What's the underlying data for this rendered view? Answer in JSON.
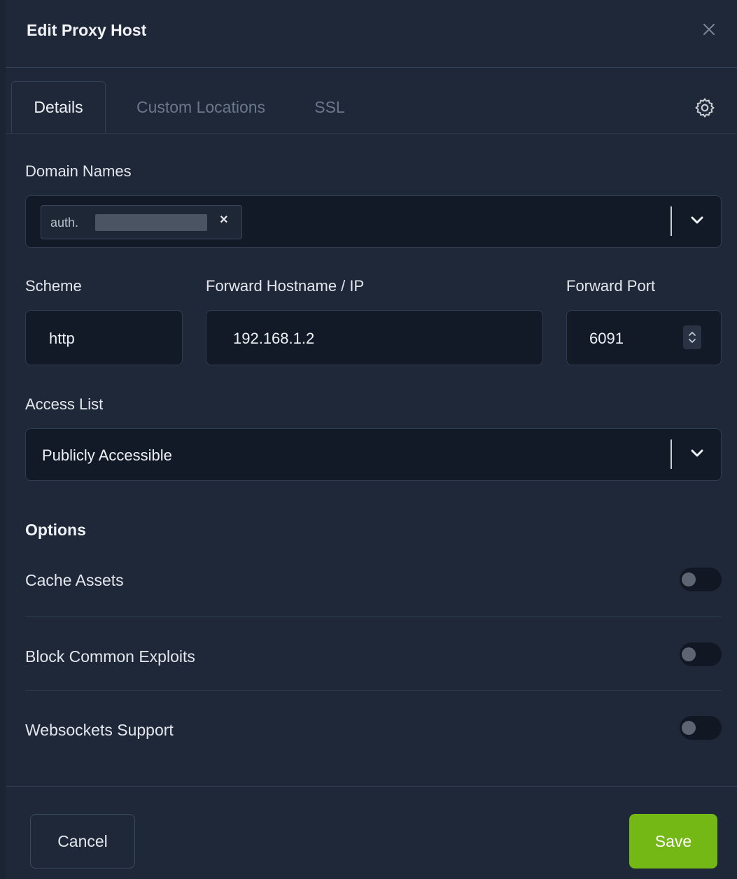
{
  "modal": {
    "title": "Edit Proxy Host"
  },
  "tabs": [
    {
      "label": "Details",
      "active": true
    },
    {
      "label": "Custom Locations",
      "active": false
    },
    {
      "label": "SSL",
      "active": false
    }
  ],
  "domain": {
    "label": "Domain Names",
    "tag_text": "auth.",
    "tag_remove": "×"
  },
  "scheme": {
    "label": "Scheme",
    "value": "http"
  },
  "forward_host": {
    "label": "Forward Hostname / IP",
    "value": "192.168.1.2"
  },
  "forward_port": {
    "label": "Forward Port",
    "value": "6091"
  },
  "access_list": {
    "label": "Access List",
    "value": "Publicly Accessible"
  },
  "options": {
    "title": "Options",
    "items": [
      {
        "label": "Cache Assets",
        "enabled": false
      },
      {
        "label": "Block Common Exploits",
        "enabled": false
      },
      {
        "label": "Websockets Support",
        "enabled": false
      }
    ]
  },
  "footer": {
    "cancel_label": "Cancel",
    "save_label": "Save"
  },
  "colors": {
    "background": "#1f2838",
    "input_background": "#121a28",
    "save_button": "#74b816"
  }
}
